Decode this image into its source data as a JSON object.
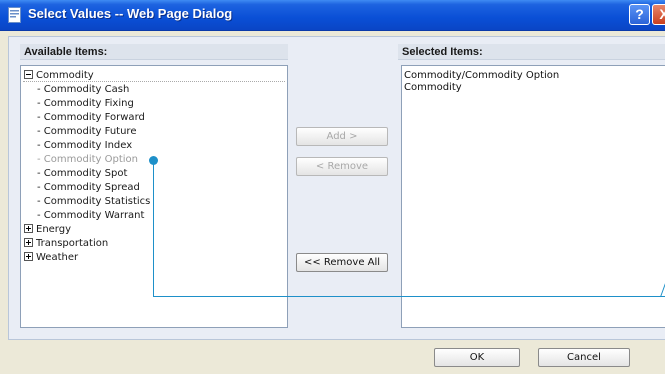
{
  "window": {
    "title": "Select Values -- Web Page Dialog",
    "help_label": "?",
    "close_label": "X"
  },
  "available": {
    "header": "Available Items:",
    "tree": [
      {
        "label": "Commodity",
        "expanded": true,
        "children": [
          {
            "label": "- Commodity Cash"
          },
          {
            "label": "- Commodity Fixing"
          },
          {
            "label": "- Commodity Forward"
          },
          {
            "label": "- Commodity Future"
          },
          {
            "label": "- Commodity Index"
          },
          {
            "label": "- Commodity Option",
            "disabled": true
          },
          {
            "label": "- Commodity Spot"
          },
          {
            "label": "- Commodity Spread"
          },
          {
            "label": "- Commodity Statistics"
          },
          {
            "label": "- Commodity Warrant"
          }
        ]
      },
      {
        "label": "Energy",
        "expanded": false
      },
      {
        "label": "Transportation",
        "expanded": false
      },
      {
        "label": "Weather",
        "expanded": false
      }
    ]
  },
  "selected": {
    "header": "Selected Items:",
    "items": [
      "Commodity/Commodity Option",
      "Commodity"
    ]
  },
  "buttons": {
    "add": "Add >",
    "remove": "< Remove",
    "remove_all": "<< Remove All",
    "ok": "OK",
    "cancel": "Cancel"
  },
  "colors": {
    "title_bar": "#0a4fd6",
    "callout": "#1e90c9",
    "disabled_text": "#9a9a9a"
  }
}
